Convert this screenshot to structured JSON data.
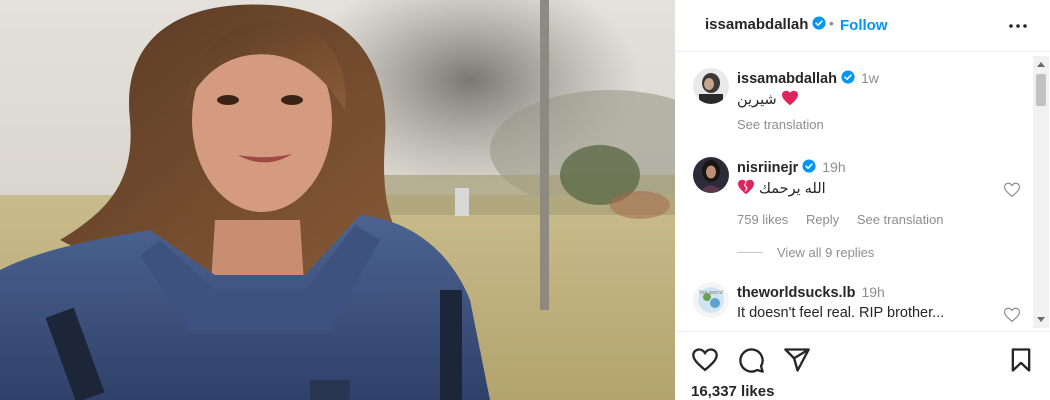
{
  "post": {
    "author": "issamabdallah",
    "dot": "•",
    "follow_label": "Follow",
    "likes": "16,337 likes"
  },
  "comments": [
    {
      "user": "issamabdallah",
      "time": "1w",
      "text": "شيرين",
      "see_translation": "See translation"
    },
    {
      "user": "nisriinejr",
      "time": "19h",
      "text": "الله يرحمك",
      "likes": "759 likes",
      "reply": "Reply",
      "see_translation": "See translation",
      "view_replies": "View all 9 replies"
    },
    {
      "user": "theworldsucks.lb",
      "time": "19h",
      "text": "It doesn't feel real. RIP brother..."
    }
  ],
  "icons": {
    "verified": "verified-badge-icon",
    "more": "more-options-icon",
    "like": "heart-icon",
    "comment": "comment-icon",
    "share": "share-icon",
    "save": "bookmark-icon"
  },
  "colors": {
    "accent": "#0095f6",
    "heart": "#ed4956",
    "text": "#262626",
    "muted": "#8e8e8e"
  }
}
